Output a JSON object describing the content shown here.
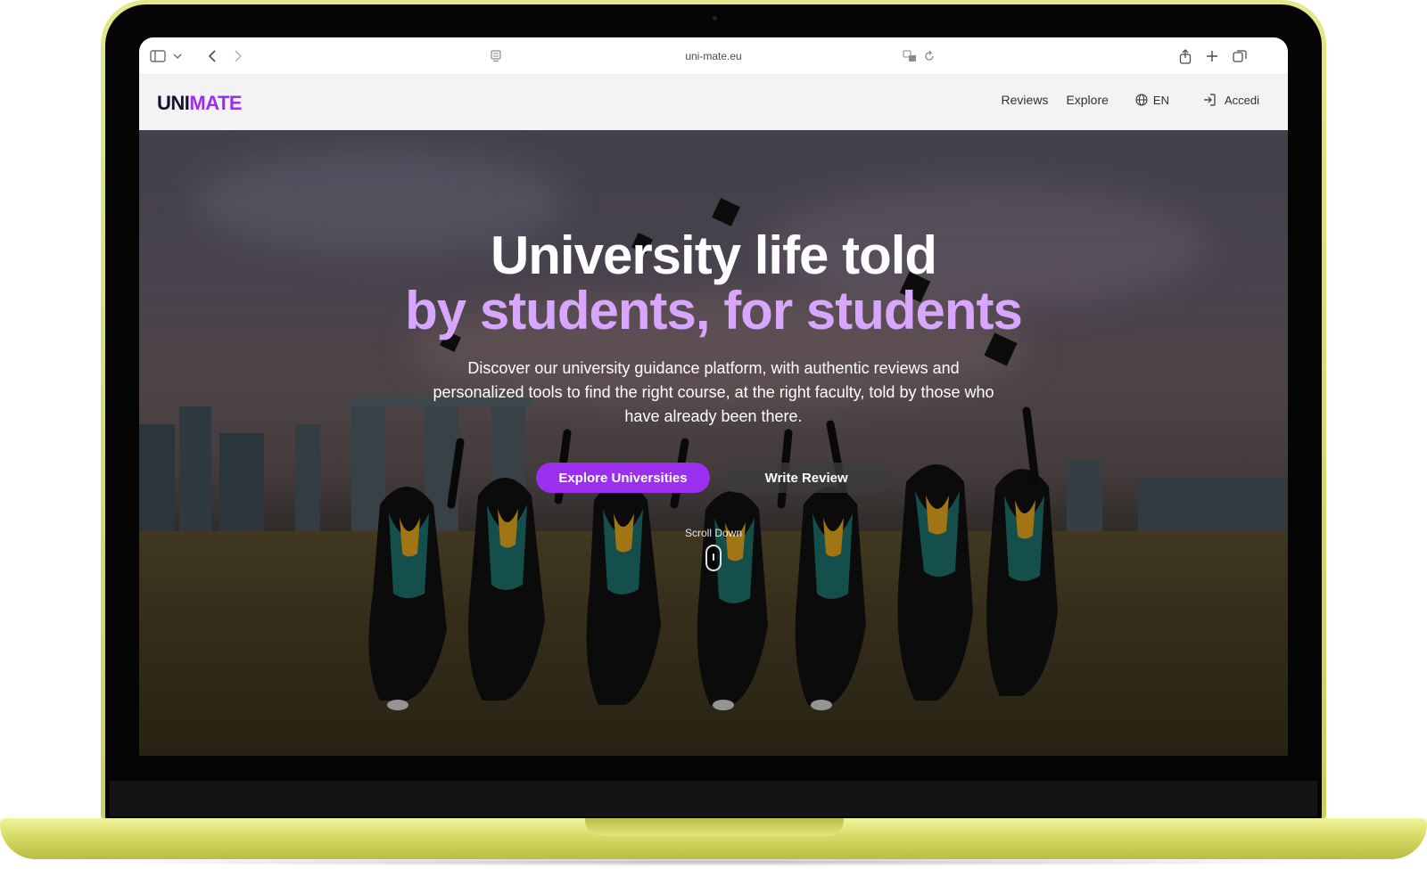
{
  "browser": {
    "url": "uni-mate.eu",
    "icons": {
      "sidebar": "sidebar-icon",
      "chevron": "chevron-down-icon",
      "back": "back-icon",
      "forward": "forward-icon",
      "page": "page-icon",
      "translate": "translate-icon",
      "reload": "reload-icon",
      "share": "share-icon",
      "new_tab": "plus-icon",
      "tabs": "tabs-overview-icon"
    }
  },
  "header": {
    "logo_part1": "UNI",
    "logo_part2": "MATE",
    "nav": {
      "reviews": "Reviews",
      "explore": "Explore",
      "language": "EN",
      "login": "Accedi"
    }
  },
  "hero": {
    "title_line1": "University life told",
    "title_line2": "by students, for students",
    "description": "Discover our university guidance platform, with authentic reviews and personalized tools to find the right course, at the right faculty, told by those who have already been there.",
    "cta_primary": "Explore Universities",
    "cta_secondary": "Write Review",
    "scroll_label": "Scroll Down"
  },
  "colors": {
    "brand_purple": "#9b2ff0",
    "accent_lilac": "#d9a6ff",
    "laptop_lime": "#d9de6a"
  }
}
